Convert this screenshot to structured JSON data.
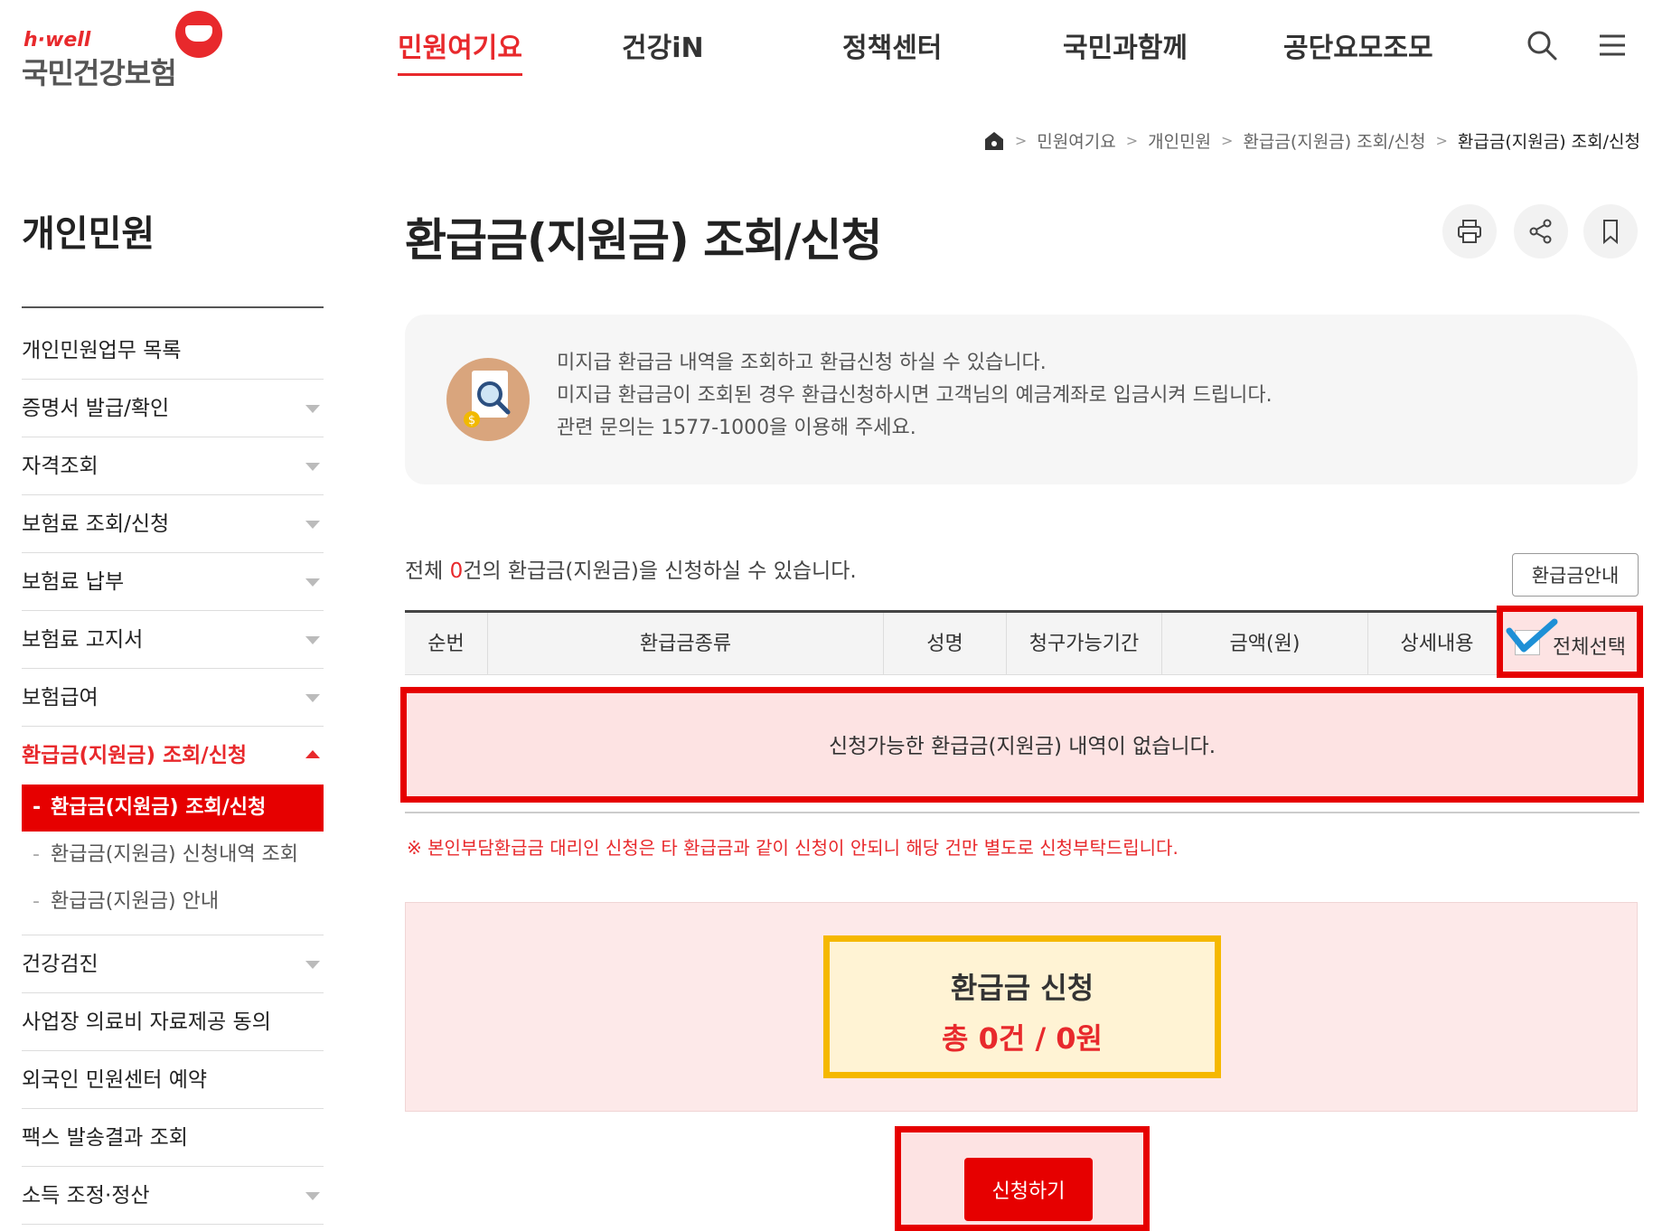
{
  "header": {
    "logo_brand": "h·well",
    "logo_name": "국민건강보험",
    "nav": [
      "민원여기요",
      "건강iN",
      "정책센터",
      "국민과함께",
      "공단요모조모"
    ]
  },
  "breadcrumb": [
    "민원여기요",
    "개인민원",
    "환급금(지원금) 조회/신청",
    "환급금(지원금) 조회/신청"
  ],
  "sidebar": {
    "title": "개인민원",
    "items_top": [
      {
        "label": "개인민원업무 목록",
        "arrow": false
      },
      {
        "label": "증명서 발급/확인",
        "arrow": true
      },
      {
        "label": "자격조회",
        "arrow": true
      },
      {
        "label": "보험료 조회/신청",
        "arrow": true
      },
      {
        "label": "보험료 납부",
        "arrow": true
      },
      {
        "label": "보험료 고지서",
        "arrow": true
      },
      {
        "label": "보험급여",
        "arrow": true
      }
    ],
    "active_item": "환급금(지원금) 조회/신청",
    "sub_items": [
      "환급금(지원금) 조회/신청",
      "환급금(지원금) 신청내역 조회",
      "환급금(지원금) 안내"
    ],
    "items_bottom": [
      {
        "label": "건강검진",
        "arrow": true
      },
      {
        "label": "사업장 의료비 자료제공 동의",
        "arrow": false
      },
      {
        "label": "외국인 민원센터 예약",
        "arrow": false
      },
      {
        "label": "팩스 발송결과 조회",
        "arrow": false
      },
      {
        "label": "소득 조정·정산",
        "arrow": true
      }
    ]
  },
  "main": {
    "title": "환급금(지원금) 조회/신청",
    "info_lines": [
      "미지급 환급금 내역을 조회하고 환급신청 하실 수 있습니다.",
      "미지급 환급금이 조회된 경우 환급신청하시면 고객님의 예금계좌로 입금시켜 드립니다.",
      "관련 문의는 1577-1000을 이용해 주세요."
    ],
    "count_prefix": "전체 ",
    "count_value": "0",
    "count_suffix": "건의 환급금(지원금)을 신청하실 수 있습니다.",
    "guide_button": "환급금안내",
    "table_headers": [
      "순번",
      "환급금종류",
      "성명",
      "청구가능기간",
      "금액(원)",
      "상세내용",
      "전체선택"
    ],
    "empty_message": "신청가능한 환급금(지원금) 내역이 없습니다.",
    "notice": "※ 본인부담환급금 대리인 신청은 타 환급금과 같이 신청이 안되니 해당 건만 별도로 신청부탁드립니다.",
    "summary_title": "환급금 신청",
    "summary_total": "총 0건 / 0원",
    "submit_button": "신청하기"
  },
  "colors": {
    "brand_red": "#e8292c",
    "highlight_red": "#e60000",
    "highlight_yellow": "#f5b800",
    "check_blue": "#1e90d6"
  }
}
